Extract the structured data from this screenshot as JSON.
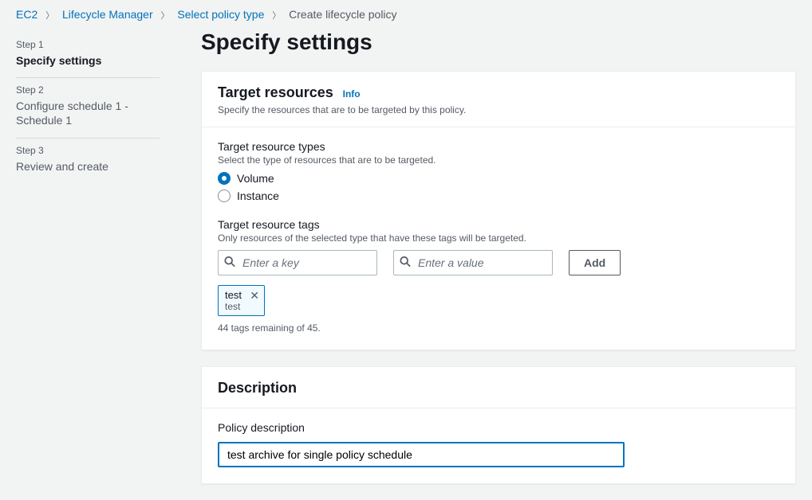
{
  "breadcrumb": {
    "ec2": "EC2",
    "lifecycle": "Lifecycle Manager",
    "select": "Select policy type",
    "current": "Create lifecycle policy"
  },
  "steps": {
    "s1_label": "Step 1",
    "s1_title": "Specify settings",
    "s2_label": "Step 2",
    "s2_title": "Configure schedule 1 - Schedule 1",
    "s3_label": "Step 3",
    "s3_title": "Review and create"
  },
  "page_title": "Specify settings",
  "target_resources": {
    "heading": "Target resources",
    "info": "Info",
    "subtitle": "Specify the resources that are to be targeted by this policy.",
    "types_label": "Target resource types",
    "types_hint": "Select the type of resources that are to be targeted.",
    "volume": "Volume",
    "instance": "Instance",
    "tags_label": "Target resource tags",
    "tags_hint": "Only resources of the selected type that have these tags will be targeted.",
    "key_placeholder": "Enter a key",
    "value_placeholder": "Enter a value",
    "add": "Add",
    "tag_key": "test",
    "tag_value": "test",
    "remaining": "44 tags remaining of 45."
  },
  "description": {
    "heading": "Description",
    "label": "Policy description",
    "value": "test archive for single policy schedule"
  }
}
